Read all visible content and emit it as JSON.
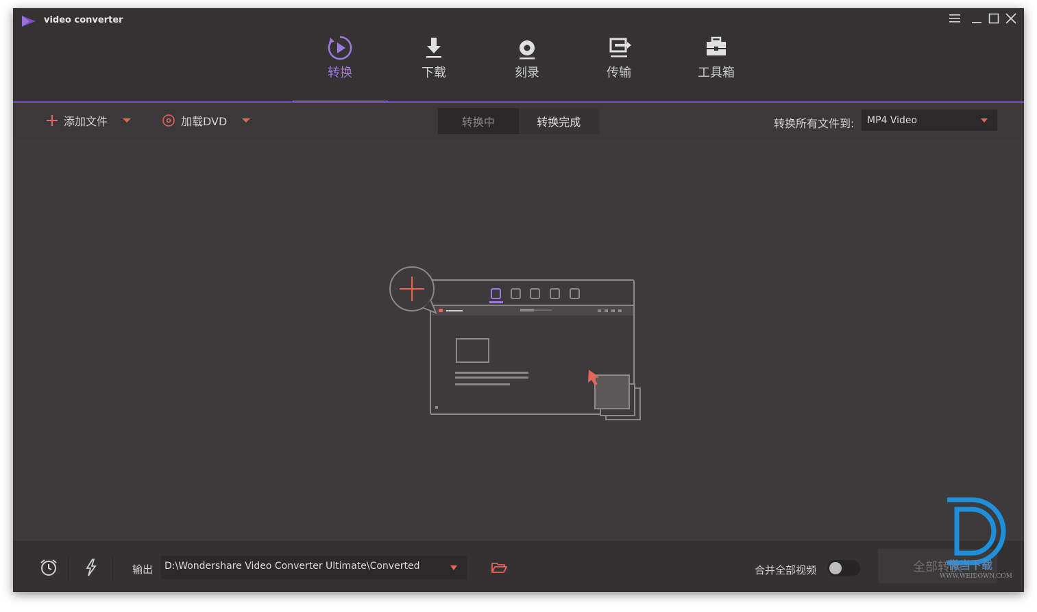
{
  "app": {
    "title": "video converter",
    "brand_color": "#7b4ec4"
  },
  "window_controls": {
    "menu_icon": "hamburger-icon",
    "minimize_icon": "minimize-icon",
    "maximize_icon": "maximize-icon",
    "close_icon": "close-icon"
  },
  "nav": {
    "tabs": [
      {
        "label": "转换",
        "icon": "play-circle-icon",
        "active": true
      },
      {
        "label": "下载",
        "icon": "download-icon",
        "active": false
      },
      {
        "label": "刻录",
        "icon": "disc-icon",
        "active": false
      },
      {
        "label": "传输",
        "icon": "transfer-icon",
        "active": false
      },
      {
        "label": "工具箱",
        "icon": "toolbox-icon",
        "active": false
      }
    ]
  },
  "toolbar": {
    "add_file_label": "添加文件",
    "load_dvd_label": "加载DVD",
    "segments": {
      "converting": "转换中",
      "converted": "转换完成"
    },
    "convert_all_to_label": "转换所有文件到:",
    "format_value": "MP4 Video"
  },
  "bottom": {
    "output_label": "输出",
    "output_path": "D:\\Wondershare Video Converter Ultimate\\Converted",
    "merge_label": "合并全部视频",
    "merge_enabled": false,
    "convert_all_button": "全部转换"
  },
  "watermark": {
    "text": "WWW.WEIDOWN.COM",
    "cn": "微当下载"
  }
}
